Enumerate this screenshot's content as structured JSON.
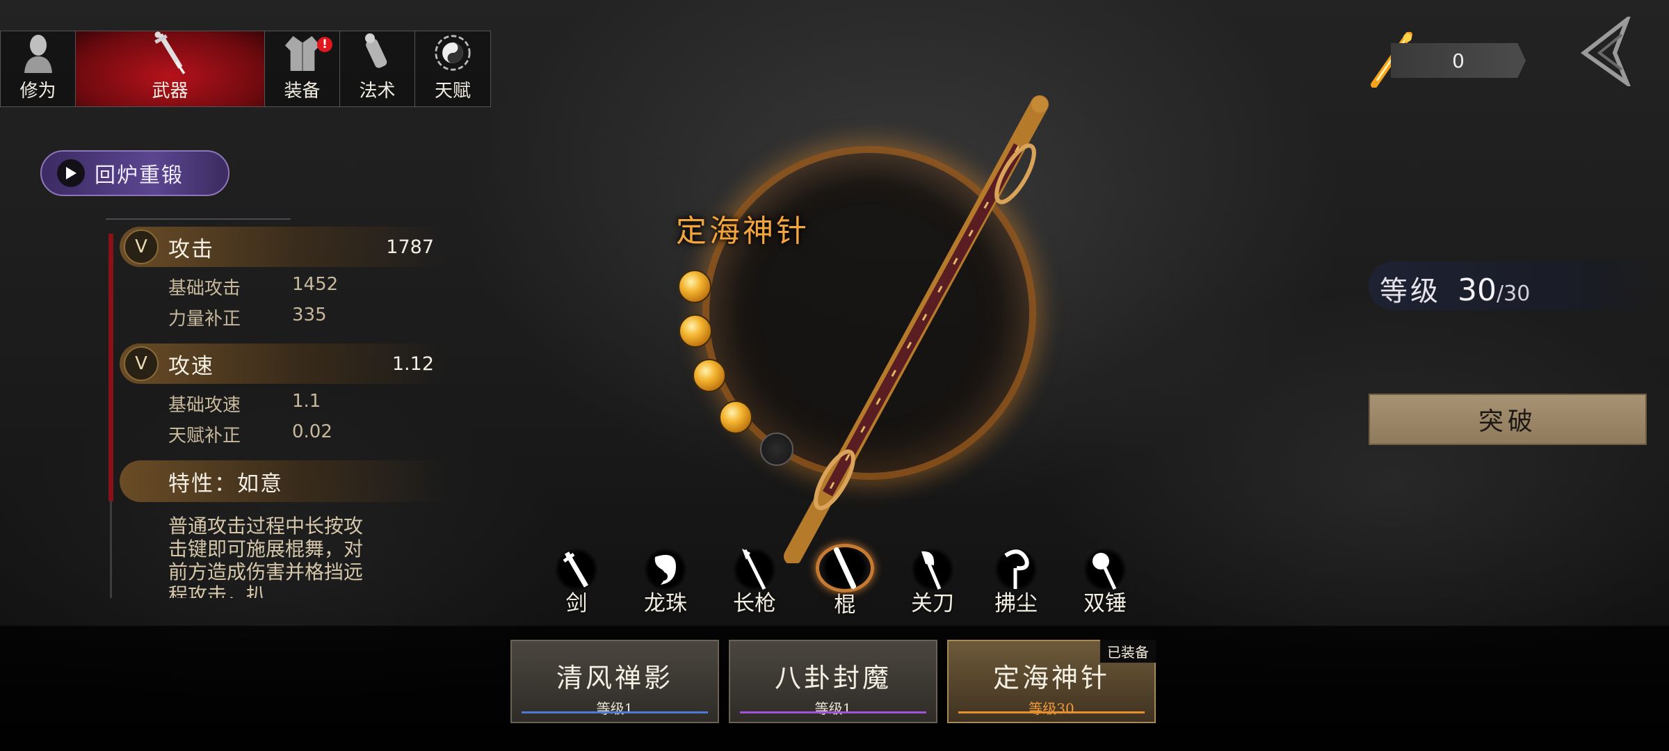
{
  "tabs": [
    {
      "label": "修为",
      "icon": "cultivator-head-icon"
    },
    {
      "label": "武器",
      "icon": "sword-icon",
      "active": true
    },
    {
      "label": "装备",
      "icon": "robe-icon",
      "badge": "!"
    },
    {
      "label": "法术",
      "icon": "scroll-icon"
    },
    {
      "label": "天赋",
      "icon": "yin-yang-icon"
    }
  ],
  "reforge": {
    "label": "回炉重锻"
  },
  "stats": {
    "attack": {
      "name": "攻击",
      "value": "1787",
      "rows": [
        {
          "k": "基础攻击",
          "v": "1452"
        },
        {
          "k": "力量补正",
          "v": "335"
        }
      ]
    },
    "speed": {
      "name": "攻速",
      "value": "1.12",
      "rows": [
        {
          "k": "基础攻速",
          "v": "1.1"
        },
        {
          "k": "天赋补正",
          "v": "0.02"
        }
      ]
    },
    "trait": {
      "name": "特性：如意",
      "desc": "普通攻击过程中长按攻击键即可施展棍舞，对前方造成伤害并格挡远程攻击，扒"
    }
  },
  "weapon": {
    "name": "定海神针",
    "orbs_filled": 4,
    "orbs_total": 5
  },
  "weapon_types": [
    {
      "label": "剑",
      "icon": "sword-type-icon"
    },
    {
      "label": "龙珠",
      "icon": "dragon-orb-icon"
    },
    {
      "label": "长枪",
      "icon": "spear-icon"
    },
    {
      "label": "棍",
      "icon": "staff-icon",
      "selected": true
    },
    {
      "label": "关刀",
      "icon": "glaive-icon"
    },
    {
      "label": "拂尘",
      "icon": "whisk-icon"
    },
    {
      "label": "双锤",
      "icon": "hammers-icon"
    }
  ],
  "weapon_cards": [
    {
      "name": "清风禅影",
      "level": "等级1",
      "bar_color": "#4a7bd6"
    },
    {
      "name": "八卦封魔",
      "level": "等级1",
      "bar_color": "#a052d8"
    },
    {
      "name": "定海神针",
      "level": "等级30",
      "bar_color": "#e8902e",
      "equipped_tag": "已装备"
    }
  ],
  "currency": {
    "value": "0"
  },
  "level": {
    "label": "等级",
    "current": "30",
    "max": "/30"
  },
  "breakthrough": {
    "label": "突破"
  }
}
